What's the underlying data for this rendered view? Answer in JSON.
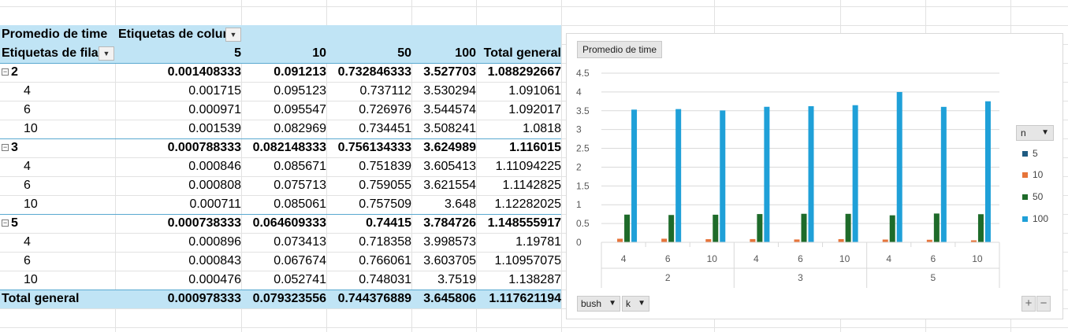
{
  "pivot": {
    "value_header": "Promedio de time",
    "col_labels_header": "Etiquetas de colum",
    "row_labels_header": "Etiquetas de fila",
    "columns": [
      "5",
      "10",
      "50",
      "100",
      "Total general"
    ],
    "groups": [
      {
        "label": "2",
        "values": [
          "0.001408333",
          "0.091213",
          "0.732846333",
          "3.527703",
          "1.088292667"
        ],
        "children": [
          {
            "label": "4",
            "values": [
              "0.001715",
              "0.095123",
              "0.737112",
              "3.530294",
              "1.091061"
            ]
          },
          {
            "label": "6",
            "values": [
              "0.000971",
              "0.095547",
              "0.726976",
              "3.544574",
              "1.092017"
            ]
          },
          {
            "label": "10",
            "values": [
              "0.001539",
              "0.082969",
              "0.734451",
              "3.508241",
              "1.0818"
            ]
          }
        ]
      },
      {
        "label": "3",
        "values": [
          "0.000788333",
          "0.082148333",
          "0.756134333",
          "3.624989",
          "1.116015"
        ],
        "children": [
          {
            "label": "4",
            "values": [
              "0.000846",
              "0.085671",
              "0.751839",
              "3.605413",
              "1.11094225"
            ]
          },
          {
            "label": "6",
            "values": [
              "0.000808",
              "0.075713",
              "0.759055",
              "3.621554",
              "1.1142825"
            ]
          },
          {
            "label": "10",
            "values": [
              "0.000711",
              "0.085061",
              "0.757509",
              "3.648",
              "1.12282025"
            ]
          }
        ]
      },
      {
        "label": "5",
        "values": [
          "0.000738333",
          "0.064609333",
          "0.74415",
          "3.784726",
          "1.148555917"
        ],
        "children": [
          {
            "label": "4",
            "values": [
              "0.000896",
              "0.073413",
              "0.718358",
              "3.998573",
              "1.19781"
            ]
          },
          {
            "label": "6",
            "values": [
              "0.000843",
              "0.067674",
              "0.766061",
              "3.603705",
              "1.10957075"
            ]
          },
          {
            "label": "10",
            "values": [
              "0.000476",
              "0.052741",
              "0.748031",
              "3.7519",
              "1.138287"
            ]
          }
        ]
      }
    ],
    "total": {
      "label": "Total general",
      "values": [
        "0.000978333",
        "0.079323556",
        "0.744376889",
        "3.645806",
        "1.117621194"
      ]
    }
  },
  "chart_buttons": {
    "title": "Promedio de time",
    "legend_field": "n",
    "axis_field_1": "bush",
    "axis_field_2": "k",
    "zoom_in": "+",
    "zoom_out": "−"
  },
  "chart_data": {
    "type": "bar",
    "title": "",
    "ylim": [
      0,
      4.5
    ],
    "yticks": [
      "0",
      "0.5",
      "1",
      "1.5",
      "2",
      "2.5",
      "3",
      "3.5",
      "4",
      "4.5"
    ],
    "grid": true,
    "legend_position": "right",
    "categories": [
      "4",
      "6",
      "10",
      "4",
      "6",
      "10",
      "4",
      "6",
      "10"
    ],
    "groups": [
      {
        "label": "2",
        "span": 3
      },
      {
        "label": "3",
        "span": 3
      },
      {
        "label": "5",
        "span": 3
      }
    ],
    "series": [
      {
        "name": "5",
        "color": "#1f5b82",
        "values": [
          0.001715,
          0.000971,
          0.001539,
          0.000846,
          0.000808,
          0.000711,
          0.000896,
          0.000843,
          0.000476
        ]
      },
      {
        "name": "10",
        "color": "#e6743a",
        "values": [
          0.095123,
          0.095547,
          0.082969,
          0.085671,
          0.075713,
          0.085061,
          0.073413,
          0.067674,
          0.052741
        ]
      },
      {
        "name": "50",
        "color": "#1e6b2a",
        "values": [
          0.737112,
          0.726976,
          0.734451,
          0.751839,
          0.759055,
          0.757509,
          0.718358,
          0.766061,
          0.748031
        ]
      },
      {
        "name": "100",
        "color": "#1fa0d8",
        "values": [
          3.530294,
          3.544574,
          3.508241,
          3.605413,
          3.621554,
          3.648,
          3.998573,
          3.603705,
          3.7519
        ]
      }
    ]
  }
}
